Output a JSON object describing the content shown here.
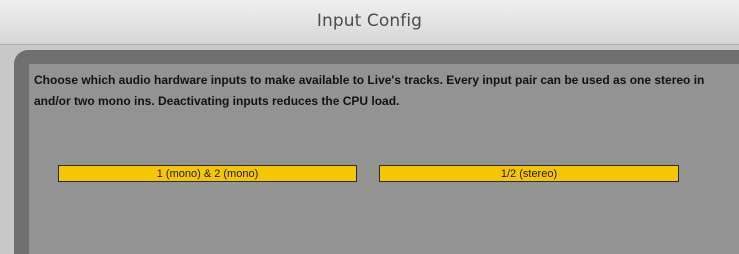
{
  "window": {
    "title": "Input Config"
  },
  "content": {
    "description": "Choose which audio hardware inputs to make available to Live's tracks. Every input pair can be used as one stereo in and/or two mono ins.  Deactivating inputs reduces the CPU load."
  },
  "inputs": [
    {
      "label": "1 (mono) & 2 (mono)",
      "active": true
    },
    {
      "label": "1/2 (stereo)",
      "active": true
    }
  ],
  "colors": {
    "active_button": "#f4c700",
    "panel": "#939393",
    "frame": "#6f6f6f"
  }
}
